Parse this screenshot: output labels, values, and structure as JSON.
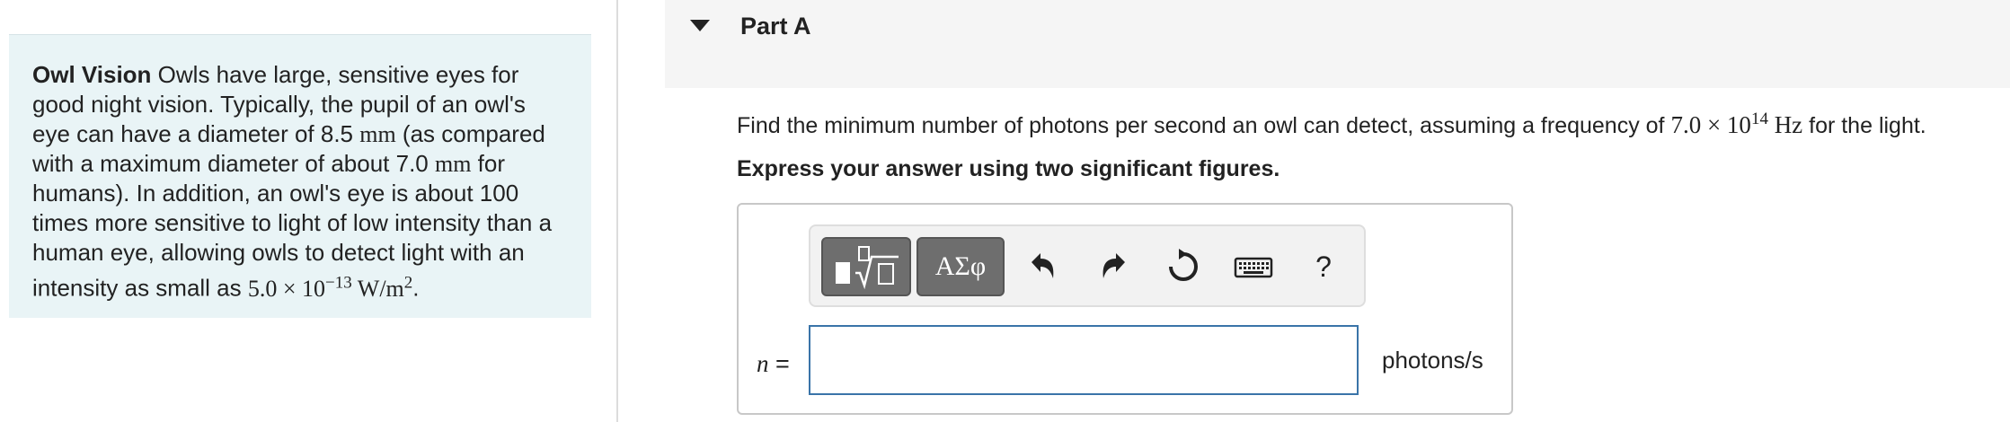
{
  "problem": {
    "title": "Owl Vision",
    "text_1": " Owls have large, sensitive eyes for good night vision. Typically, the pupil of an owl's eye can have a diameter of 8.5 ",
    "unit_mm_1": "mm",
    "text_2": " (as compared with a maximum diameter of about 7.0 ",
    "unit_mm_2": "mm",
    "text_3": " for humans). In addition, an owl's eye is about 100 times more sensitive to light of low intensity than a human eye, allowing owls to detect light with an intensity as small as ",
    "intensity_mantissa": "5.0 × 10",
    "intensity_exponent": "−13",
    "intensity_unit": " W/m",
    "intensity_unit_exp": "2",
    "text_end": "."
  },
  "part": {
    "title": "Part A"
  },
  "question": {
    "text_before": "Find the minimum number of photons per second an owl can detect, assuming a frequency of ",
    "freq_mantissa": "7.0 × 10",
    "freq_exponent": "14",
    "freq_unit": " Hz",
    "text_after": " for the light."
  },
  "instruction": "Express your answer using two significant figures.",
  "toolbar": {
    "symbols_label": "ΑΣφ",
    "help_label": "?"
  },
  "answer": {
    "variable": "n",
    "equals": " =",
    "value": "",
    "unit": "photons/s"
  },
  "colors": {
    "problem_bg": "#e9f4f6",
    "input_border": "#3a74a8",
    "toolbar_button": "#6e6e6e"
  }
}
